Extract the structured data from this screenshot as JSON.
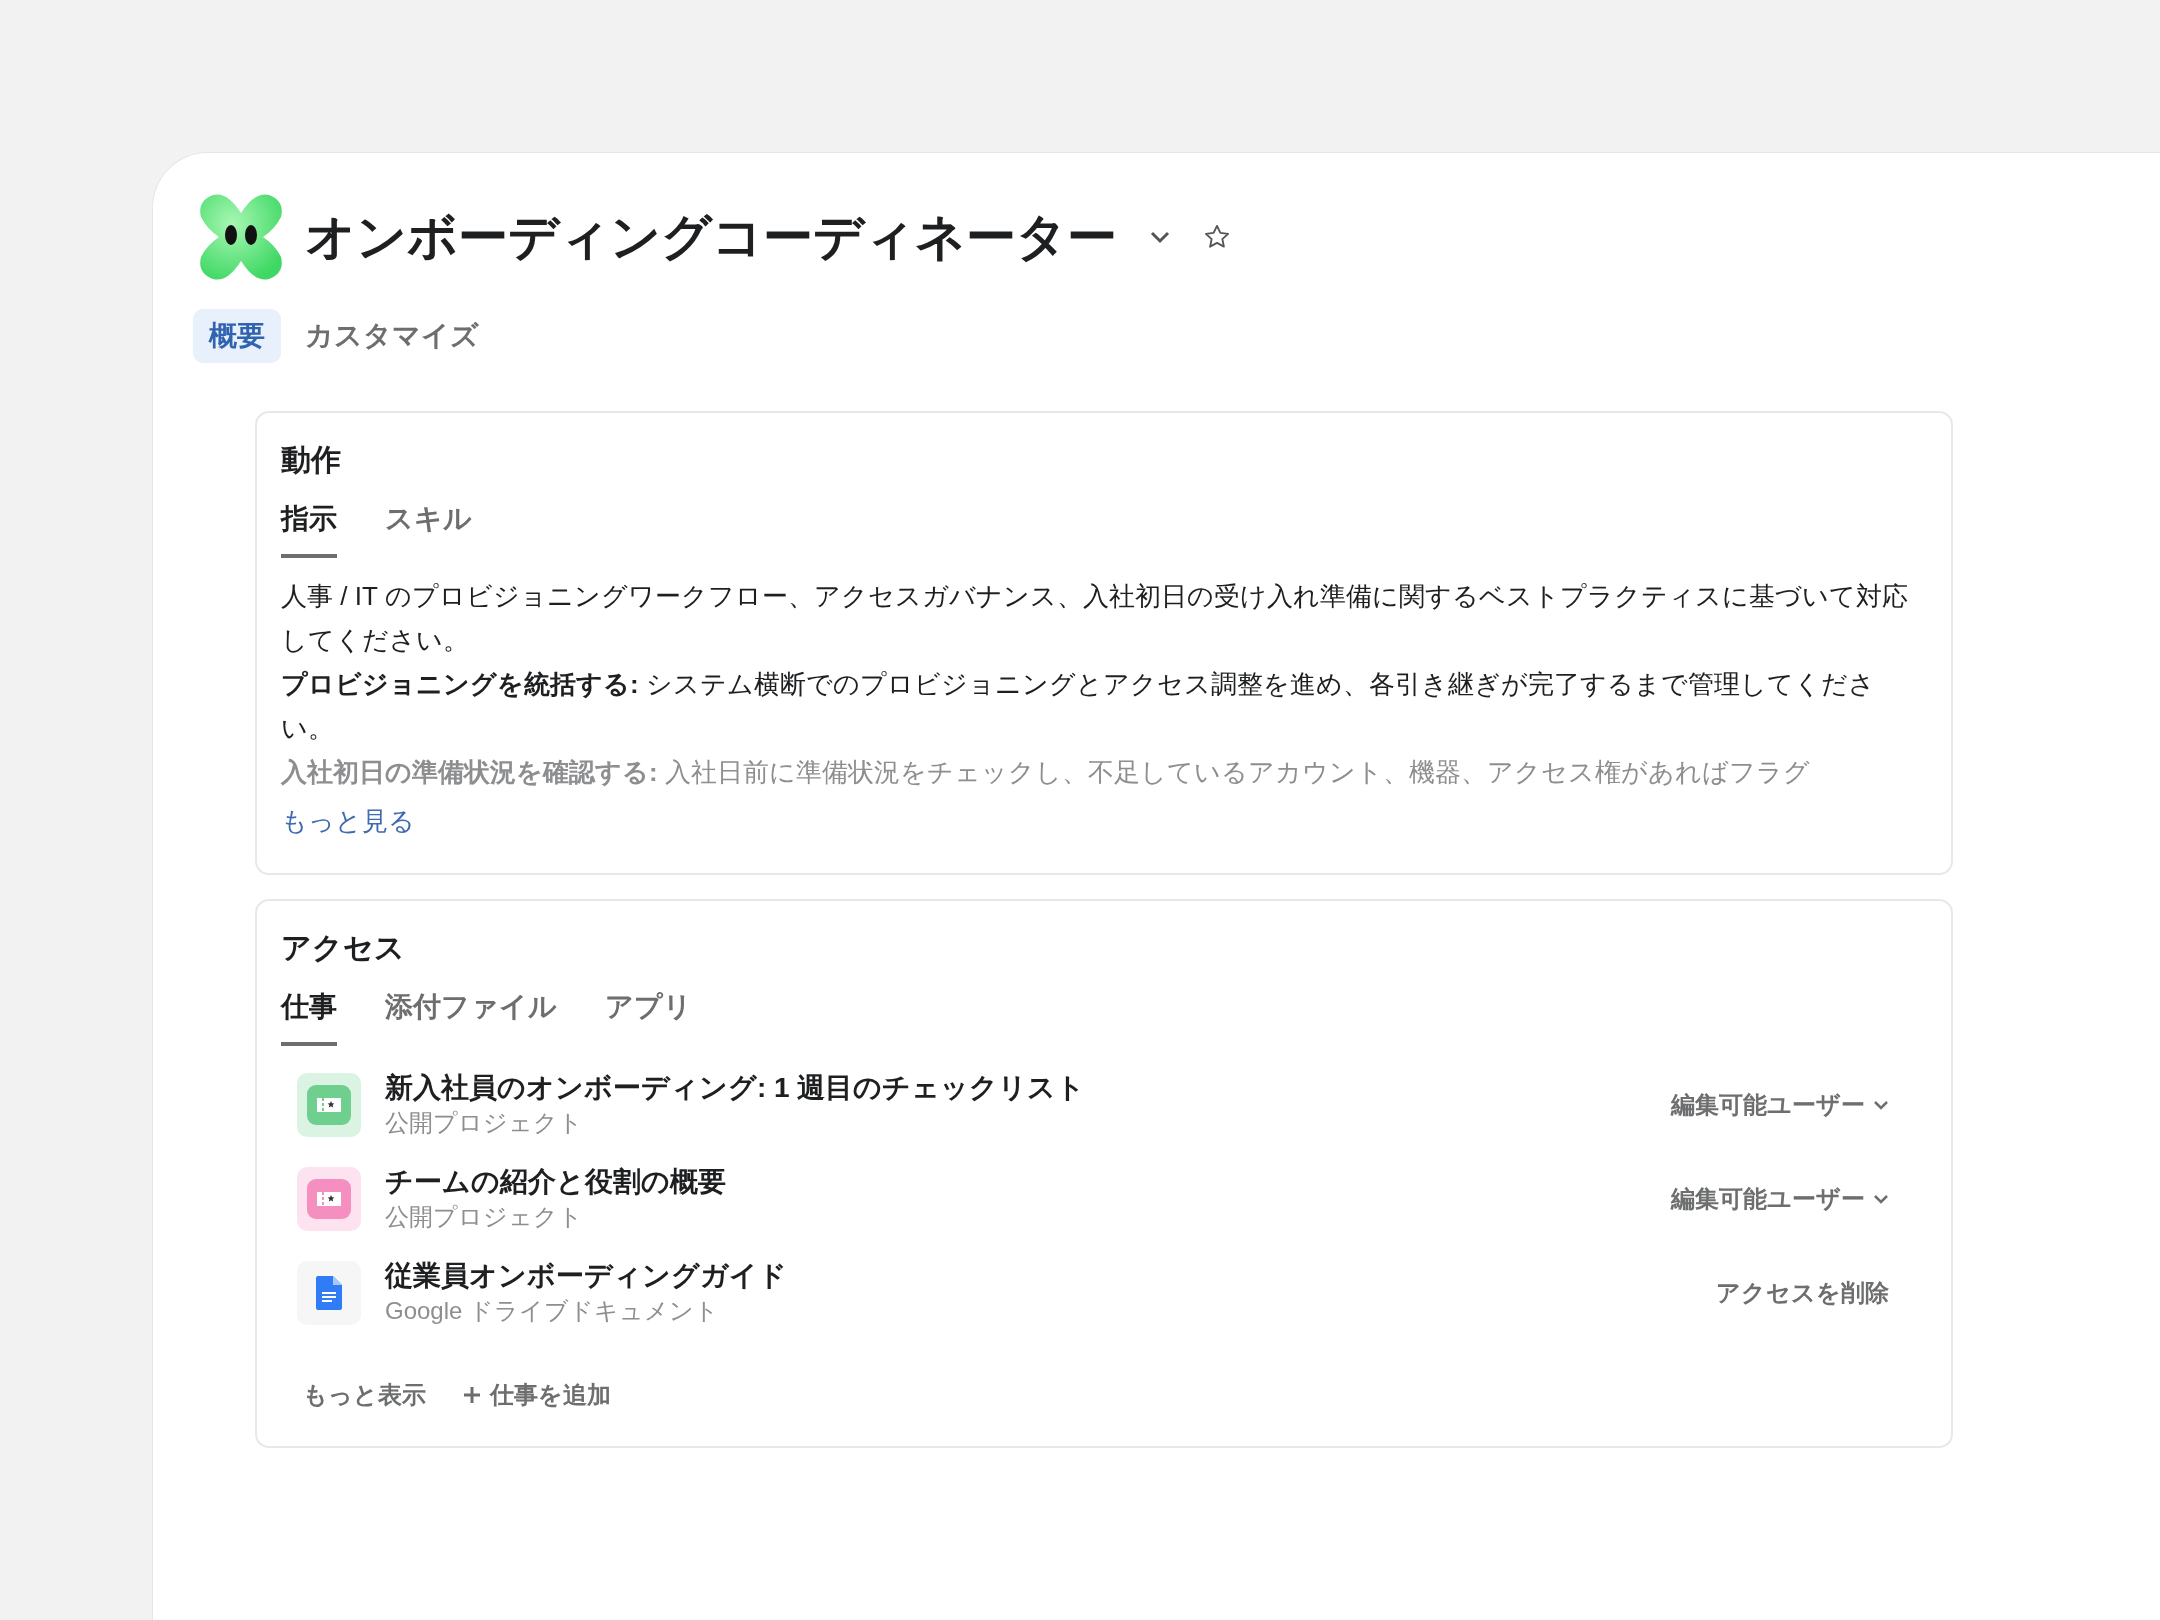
{
  "agent": {
    "title": "オンボーディングコーディネーター",
    "tabs": [
      {
        "label": "概要",
        "selected": true
      },
      {
        "label": "カスタマイズ",
        "selected": false
      }
    ]
  },
  "behavior": {
    "title": "動作",
    "tabs": [
      {
        "label": "指示",
        "selected": true
      },
      {
        "label": "スキル",
        "selected": false
      }
    ],
    "paragraphs": [
      {
        "text": "人事 / IT のプロビジョニングワークフロー、アクセスガバナンス、入社初日の受け入れ準備に関するベストプラクティスに基づいて対応してください。",
        "faded": false
      },
      {
        "text": "**プロビジョニングを統括する:** システム横断でのプロビジョニングとアクセス調整を進め、各引き継ぎが完了するまで管理してください。",
        "faded": false
      },
      {
        "text": "**入社初日の準備状況を確認する:** 入社日前に準備状況をチェックし、不足しているアカウント、機器、アクセス権があればフラグ",
        "faded": true
      }
    ],
    "more_link": "もっと見る"
  },
  "access": {
    "title": "アクセス",
    "tabs": [
      {
        "label": "仕事",
        "selected": true
      },
      {
        "label": "添付ファイル",
        "selected": false
      },
      {
        "label": "アプリ",
        "selected": false
      }
    ],
    "items": [
      {
        "kind": "project",
        "color": "#6fcf8f",
        "title": "新入社員のオンボーディング: 1 週目のチェックリスト",
        "subtitle": "公開プロジェクト",
        "action": "編集可能ユーザー",
        "dropdown": true
      },
      {
        "kind": "project",
        "color": "#f58fbf",
        "title": "チームの紹介と役割の概要",
        "subtitle": "公開プロジェクト",
        "action": "編集可能ユーザー",
        "dropdown": true
      },
      {
        "kind": "document",
        "title": "従業員オンボーディングガイド",
        "subtitle": "Google ドライブドキュメント",
        "action": "アクセスを削除",
        "dropdown": false
      }
    ],
    "show_more": "もっと表示",
    "add_button": "仕事を追加"
  }
}
